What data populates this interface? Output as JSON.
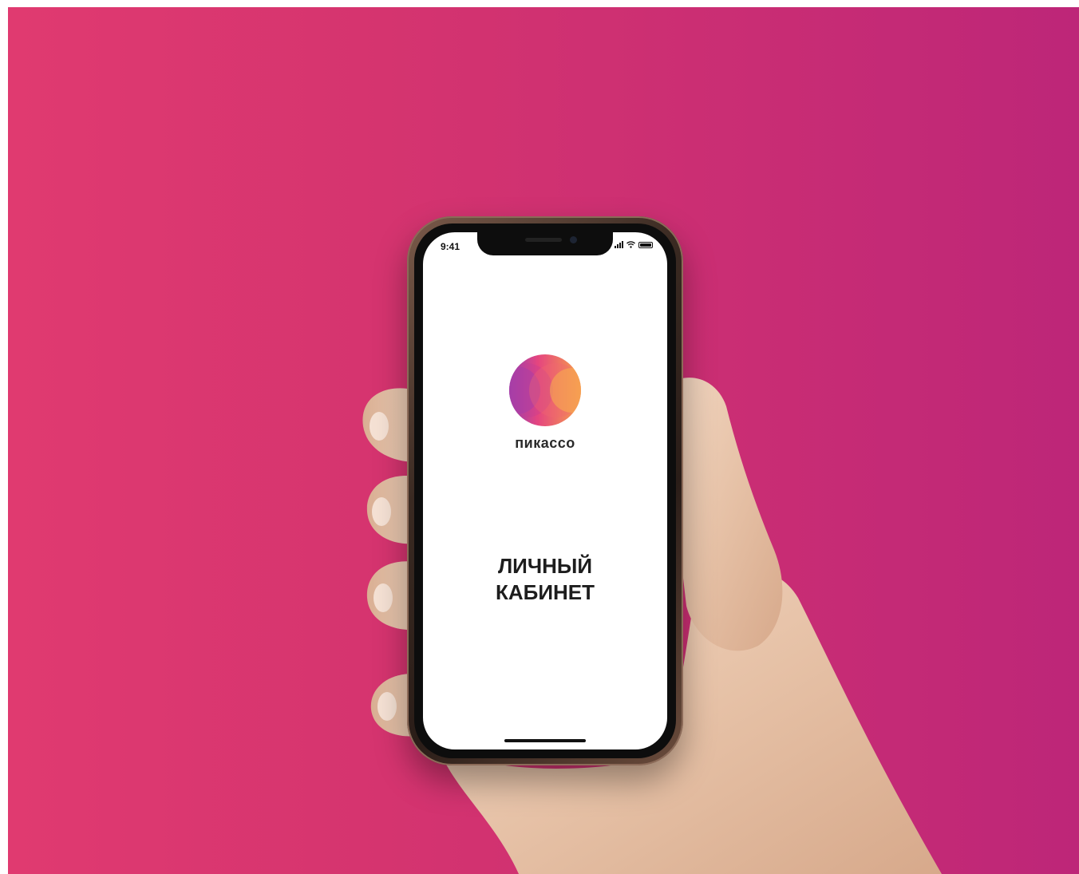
{
  "phone": {
    "status_time": "9:41",
    "status_icons": [
      "signal-icon",
      "wifi-icon",
      "battery-icon"
    ]
  },
  "app": {
    "brand": "пикассо",
    "title_line1": "ЛИЧНЫЙ",
    "title_line2": "КАБИНЕТ",
    "logo_icon": "picasso-logo-icon"
  },
  "colors": {
    "background_left": "#e03a70",
    "background_right": "#bd2678",
    "logo_orange": "#f6a14a",
    "logo_pink": "#e5457f",
    "logo_purple": "#8f40b5"
  }
}
